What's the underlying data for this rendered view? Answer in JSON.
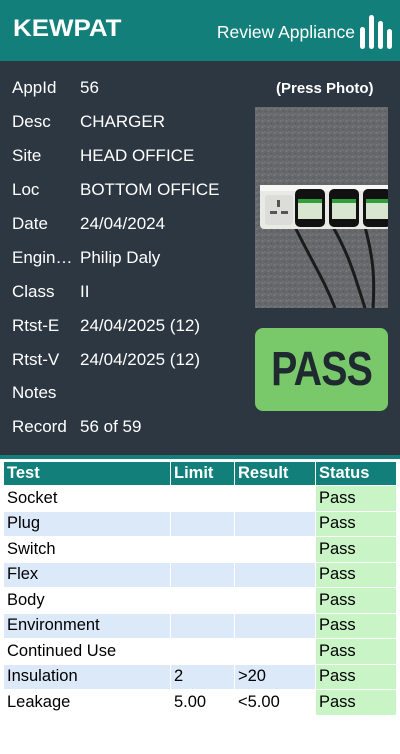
{
  "header": {
    "logo": "KEWPAT",
    "title": "Review Appliance",
    "menu_icon": "bar-chart-icon"
  },
  "details": [
    {
      "label": "AppId",
      "value": "56"
    },
    {
      "label": "Desc",
      "value": "CHARGER"
    },
    {
      "label": "Site",
      "value": "HEAD OFFICE"
    },
    {
      "label": "Loc",
      "value": "BOTTOM OFFICE"
    },
    {
      "label": "Date",
      "value": "24/04/2024"
    },
    {
      "label": "Engin…",
      "value": "Philip Daly"
    },
    {
      "label": "Class",
      "value": "II"
    },
    {
      "label": "Rtst-E",
      "value": "24/04/2025 (12)"
    },
    {
      "label": "Rtst-V",
      "value": "24/04/2025 (12)"
    },
    {
      "label": "Notes",
      "value": ""
    },
    {
      "label": "Record",
      "value": "56 of 59"
    }
  ],
  "photo": {
    "caption": "(Press Photo)"
  },
  "result_badge": "PASS",
  "table": {
    "headers": [
      "Test",
      "Limit",
      "Result",
      "Status"
    ],
    "rows": [
      [
        "Socket",
        "",
        "",
        "Pass"
      ],
      [
        "Plug",
        "",
        "",
        "Pass"
      ],
      [
        "Switch",
        "",
        "",
        "Pass"
      ],
      [
        "Flex",
        "",
        "",
        "Pass"
      ],
      [
        "Body",
        "",
        "",
        "Pass"
      ],
      [
        "Environment",
        "",
        "",
        "Pass"
      ],
      [
        "Continued Use",
        "",
        "",
        "Pass"
      ],
      [
        "Insulation",
        "2",
        ">20",
        "Pass"
      ],
      [
        "Leakage",
        "5.00",
        "<5.00",
        "Pass"
      ]
    ]
  },
  "colors": {
    "brand_teal": "#127f7a",
    "panel_bg": "#2d3741",
    "pass_green": "#79c86a",
    "row_alt": "#dbe9f8",
    "status_bg": "#c9f5c6"
  }
}
